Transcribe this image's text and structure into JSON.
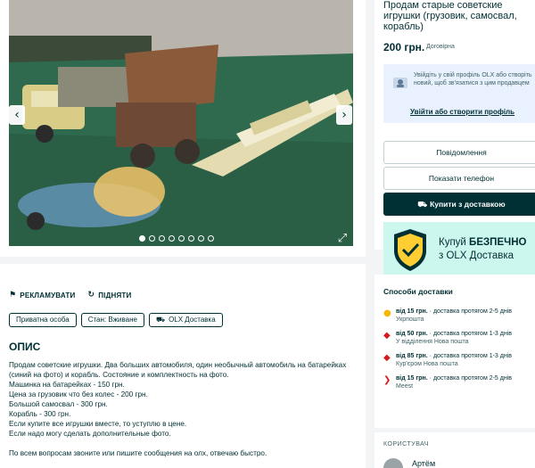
{
  "listing": {
    "title": "Продам старые советские игрушки (грузовик, самосвал, корабль)",
    "price": "200 грн.",
    "price_note": "Договірна"
  },
  "gallery": {
    "dots_total": 8,
    "active_dot": 0
  },
  "profile_prompt": {
    "text": "Увійдіть у свій профіль OLX або створіть новий, щоб зв'язатися з цим продавцем",
    "link": "Увійти або створити профіль"
  },
  "buttons": {
    "message": "Повідомлення",
    "show_phone": "Показати телефон",
    "buy_delivery": "Купити з доставкою"
  },
  "banner": {
    "line1_prefix": "Купуй ",
    "line1_strong": "БЕЗПЕЧНО",
    "line2": "з OLX Доставка"
  },
  "actions": {
    "advertise": "РЕКЛАМУВАТИ",
    "raise": "ПІДНЯТИ"
  },
  "tags": [
    "Приватна особа",
    "Стан: Вживане",
    "OLX Доставка"
  ],
  "description": {
    "title": "ОПИС",
    "text": "Продам советские игрушки. Два больших автомобиля, один необычный автомобиль на батарейках (синий на фото) и корабль. Состояние и комплектность на фото.\nМашинка на батарейках - 150 грн.\nЦена за грузовик что без колес - 200 грн.\nБольшой самосвал - 300 грн.\nКорабль - 300 грн.\nЕсли купите все игрушки вместе, то уступлю в цене.\nЕсли надо могу сделать дополнительные фото.\n\nПо всем вопросам звоните или пишите сообщения на олх, отвечаю быстро."
  },
  "delivery": {
    "title": "Способи доставки",
    "items": [
      {
        "price": "від 15 грн.",
        "rest": " · доставка протягом 2-5 днів",
        "carrier": "Укрпошта",
        "color": "#f5b500",
        "icon": "ukrposhta-icon"
      },
      {
        "price": "від 50 грн.",
        "rest": " · доставка протягом 1-3 днів",
        "carrier": "У відділення Нова пошта",
        "color": "#d71920",
        "icon": "novaposhta-icon"
      },
      {
        "price": "від 85 грн.",
        "rest": " · доставка протягом 1-3 днів",
        "carrier": "Кур'єром Нова пошта",
        "color": "#d71920",
        "icon": "novaposhta-courier-icon"
      },
      {
        "price": "від 15 грн.",
        "rest": " · доставка протягом 2-5 днів",
        "carrier": "Meest",
        "color": "#d71920",
        "icon": "meest-icon"
      }
    ]
  },
  "seller": {
    "heading": "КОРИСТУВАЧ",
    "name": "Артём"
  }
}
